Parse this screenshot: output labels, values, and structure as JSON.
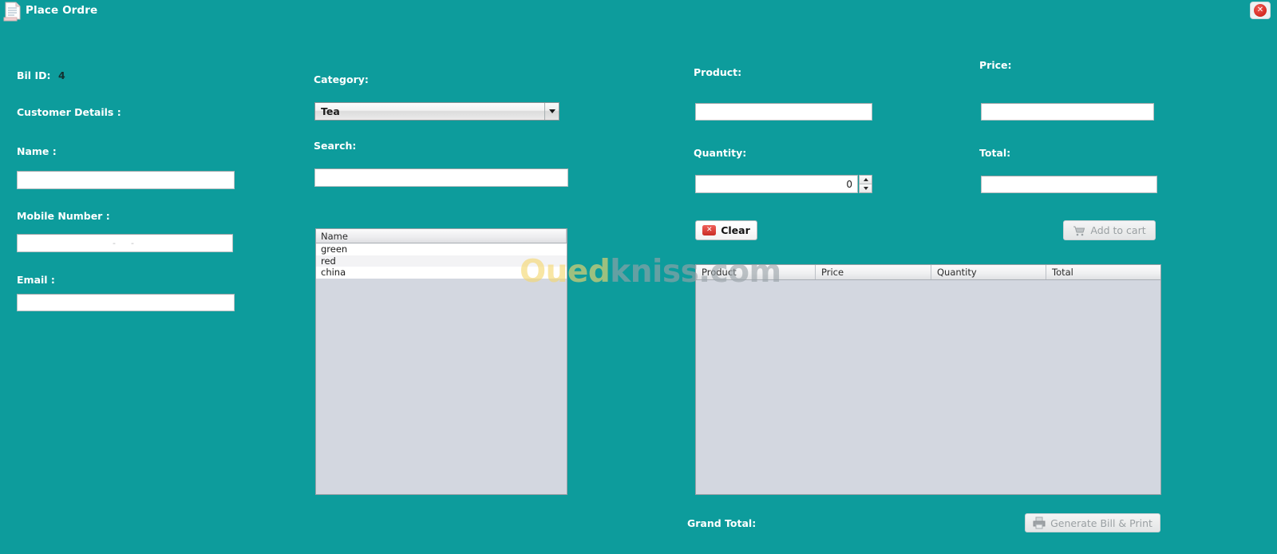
{
  "window": {
    "title": "Place Ordre",
    "icon": "document-icon",
    "close_label": "✕",
    "background_color": "#0d9c9c"
  },
  "watermark": {
    "part_highlight": "Oued",
    "part_rest": "kniss.com",
    "highlight_color": "#f5d76e",
    "rest_color": "#9aa3a8"
  },
  "bill": {
    "id_label": "Bil ID:",
    "id_value": "4"
  },
  "customer": {
    "section_label": "Customer Details :",
    "name_label": "Name :",
    "name_value": "",
    "name_placeholder": "",
    "mobile_label": "Mobile Number :",
    "mobile_value": " -  - ",
    "email_label": "Email :",
    "email_value": "",
    "email_placeholder": ""
  },
  "catalog": {
    "category_label": "Category:",
    "category_selected": "Tea",
    "category_options": [
      "Tea"
    ],
    "search_label": "Search:",
    "search_value": "",
    "search_placeholder": "",
    "list_header": "Name",
    "list_items": [
      "green",
      "red",
      "china"
    ]
  },
  "item": {
    "product_label": "Product:",
    "product_value": "",
    "price_label": "Price:",
    "price_value": "",
    "quantity_label": "Quantity:",
    "quantity_value": "0",
    "total_label": "Total:",
    "total_value": "",
    "clear_label": "Clear",
    "clear_icon": "red-x-icon",
    "add_to_cart_label": "Add to cart",
    "add_to_cart_icon": "cart-icon",
    "add_to_cart_enabled": false
  },
  "cart": {
    "columns": [
      "Product",
      "Price",
      "Quantity",
      "Total"
    ],
    "rows": [],
    "grand_total_label": "Grand Total:",
    "grand_total_value": "",
    "generate_label": "Generate Bill & Print",
    "generate_icon": "printer-icon",
    "generate_enabled": false
  }
}
